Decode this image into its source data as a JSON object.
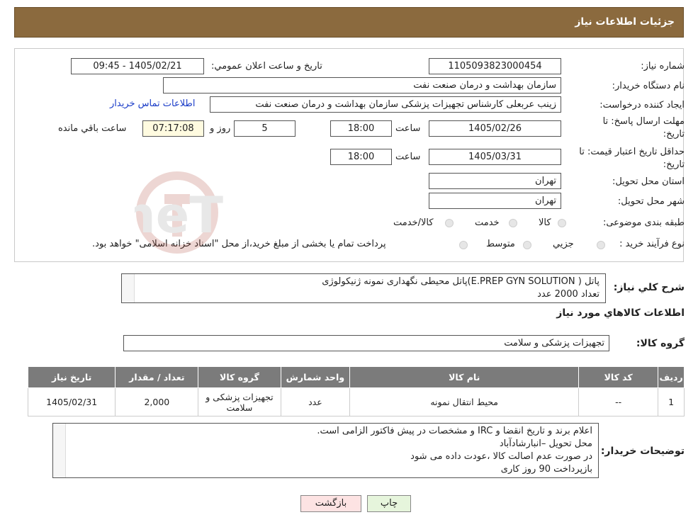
{
  "header": {
    "title": "جزئیات اطلاعات نیاز"
  },
  "fields": {
    "need_number_label": "شماره نیاز:",
    "need_number": "1105093823000454",
    "announce_label": "تاریخ و ساعت اعلان عمومي:",
    "announce_value": "1405/02/21 - 09:45",
    "buyer_label": "نام دستگاه خريدار:",
    "buyer_value": "سازمان بهداشت و درمان صنعت نفت",
    "creator_label": "ايجاد كننده درخواست:",
    "creator_value": "زینب عربعلی کارشناس تجهیزات پزشکی سازمان بهداشت و درمان صنعت نفت",
    "contact_link": "اطلاعات تماس خريدار",
    "deadline_label_1": "مهلت ارسال پاسخ: تا",
    "deadline_label_2": "تاريخ:",
    "deadline_date": "1405/02/26",
    "time_label": "ساعت",
    "deadline_time": "18:00",
    "days_value": "5",
    "days_label": "روز و",
    "remaining_time": "07:17:08",
    "remaining_label": "ساعت باقي مانده",
    "validity_label_1": "حداقل تاريخ اعتبار قيمت: تا",
    "validity_label_2": "تاريخ:",
    "validity_date": "1405/03/31",
    "validity_time": "18:00",
    "province_label": "استان محل تحويل:",
    "province_value": "تهران",
    "city_label": "شهر محل تحويل:",
    "city_value": "تهران",
    "category_label": "طبقه بندی موضوعی:",
    "category_options": [
      "كالا",
      "خدمت",
      "كالا/خدمت"
    ],
    "process_label": "نوع فرآيند خريد :",
    "process_options": [
      "جزيي",
      "متوسط"
    ],
    "process_note": "پرداخت تمام يا بخشی از مبلغ خريد،از محل \"اسناد خزانه اسلامی\" خواهد بود."
  },
  "summary": {
    "label": "شرح كلي نياز:",
    "line1": "پاتل ( E.PREP GYN SOLUTION)پاتل محیطی نگهداری نمونه ژنیکولوژی",
    "line2": "تعداد 2000 عدد"
  },
  "goods_section_title": "اطلاعات كالاهاي مورد نياز",
  "goods_group": {
    "label": "گروه كالا:",
    "value": "تجهیزات پزشکی و سلامت"
  },
  "table": {
    "headers": [
      "رديف",
      "كد كالا",
      "نام كالا",
      "واحد شمارش",
      "گروه كالا",
      "تعداد / مقدار",
      "تاريخ نياز"
    ],
    "rows": [
      [
        "1",
        "--",
        "محیط انتقال نمونه",
        "عدد",
        "تجهیزات پزشکی و سلامت",
        "2,000",
        "1405/02/31"
      ]
    ]
  },
  "buyer_notes": {
    "label": "توضيحات خريدار:",
    "lines": [
      "اعلام برند و تاریخ انقضا  و IRC  و مشخصات  در پیش فاکتور الزامی است.",
      "محل تحویل –انبارشادآباد",
      "در صورت عدم اصالت کالا ،عودت داده می شود",
      "بازپرداخت 90 روز کاری"
    ]
  },
  "buttons": {
    "print": "چاپ",
    "back": "بازگشت"
  },
  "watermark_text": "AriaTender.neT",
  "colors": {
    "header_bg": "#8b6a3e",
    "table_header": "#7b7b7b",
    "yellow_box": "#fffbe0",
    "link": "#1a3cc8",
    "print_btn": "#e6f5dc",
    "back_btn": "#fde3e3"
  }
}
